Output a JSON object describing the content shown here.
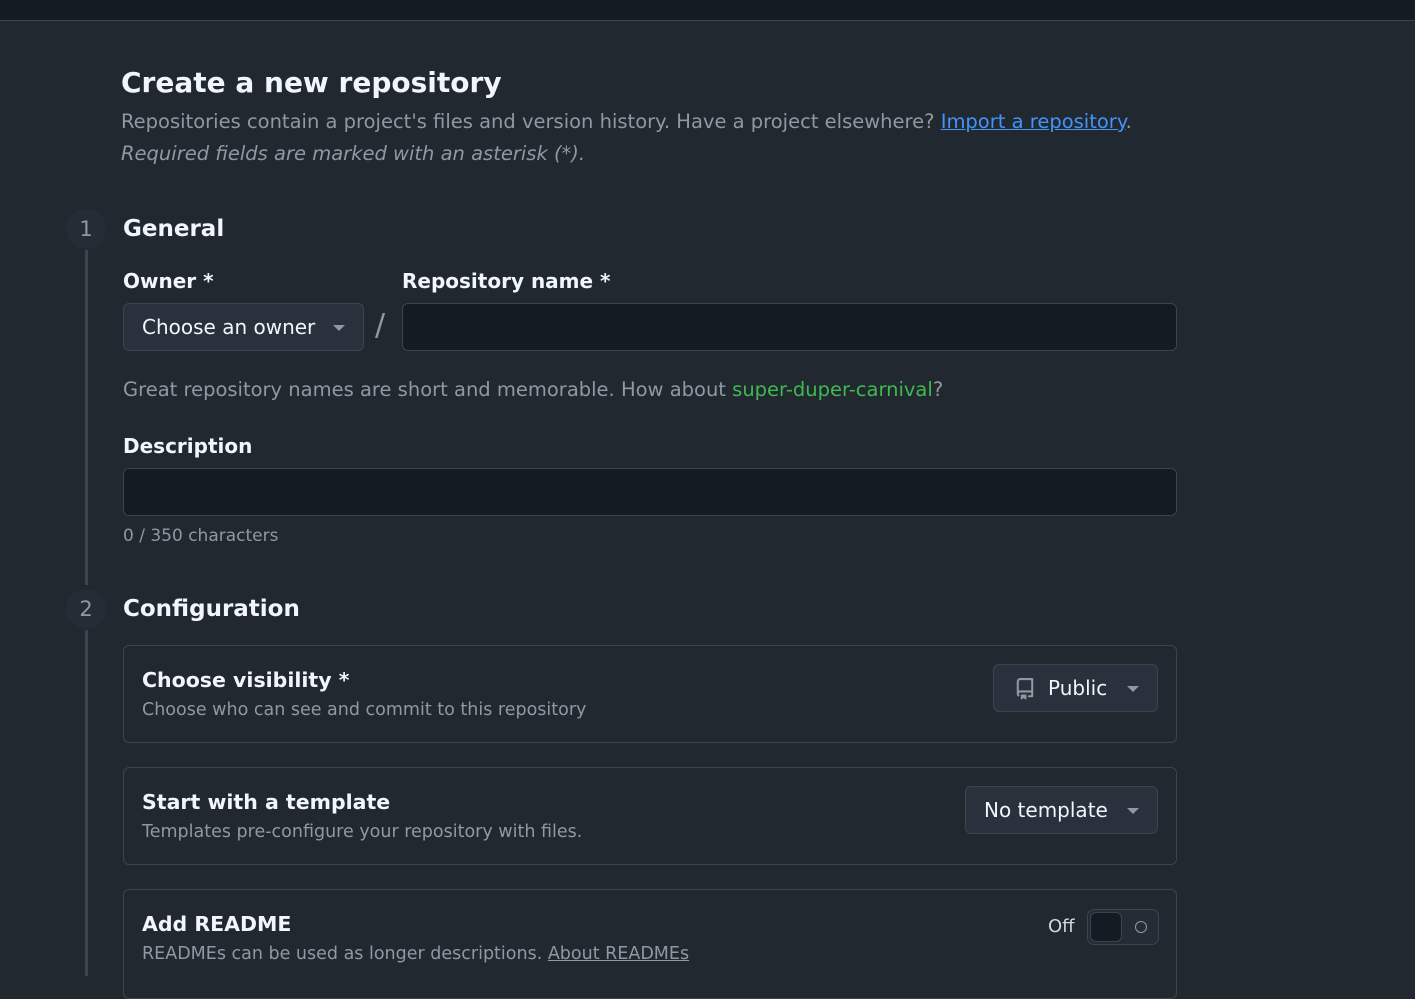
{
  "header": {
    "title": "Create a new repository",
    "subtitle_text": "Repositories contain a project's files and version history. Have a project elsewhere? ",
    "import_link": "Import a repository",
    "subtitle_end": ".",
    "required_note": "Required fields are marked with an asterisk (*)."
  },
  "steps": [
    {
      "number": "1",
      "title": "General"
    },
    {
      "number": "2",
      "title": "Configuration"
    }
  ],
  "general": {
    "owner_label": "Owner *",
    "owner_value": "Choose an owner",
    "slash": "/",
    "repo_name_label": "Repository name *",
    "repo_name_value": "",
    "suggestion_prefix": "Great repository names are short and memorable. How about ",
    "suggestion_name": "super-duper-carnival",
    "suggestion_suffix": "?",
    "description_label": "Description",
    "description_value": "",
    "char_count": "0 / 350 characters"
  },
  "configuration": {
    "visibility": {
      "title": "Choose visibility *",
      "description": "Choose who can see and commit to this repository",
      "value": "Public",
      "icon": "repo-icon"
    },
    "template": {
      "title": "Start with a template",
      "description": "Templates pre-configure your repository with files.",
      "value": "No template"
    },
    "readme": {
      "title": "Add README",
      "description": "READMEs can be used as longer descriptions. ",
      "link": "About READMEs",
      "toggle_label": "Off"
    }
  }
}
